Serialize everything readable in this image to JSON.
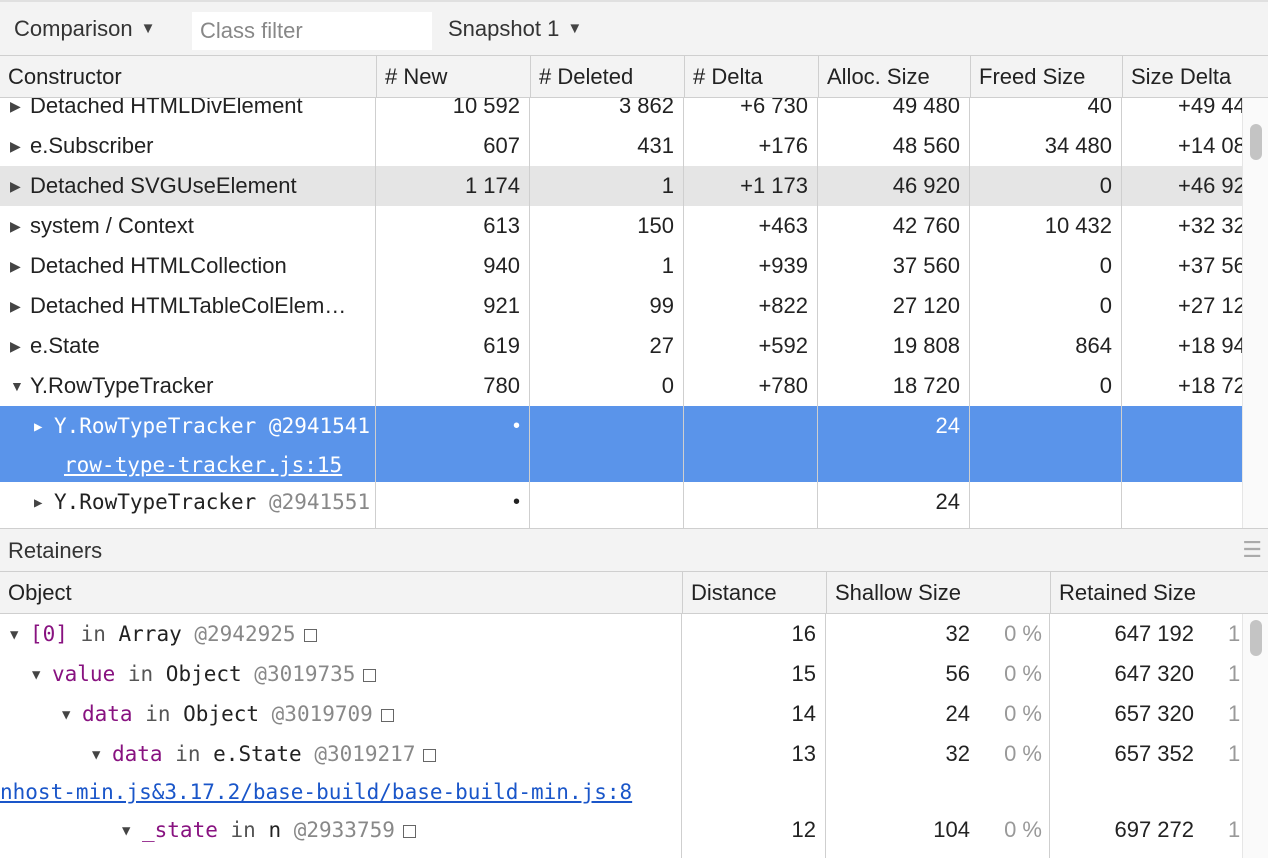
{
  "toolbar": {
    "view_mode": "Comparison",
    "class_filter_placeholder": "Class filter",
    "snapshot": "Snapshot 1"
  },
  "top_table": {
    "columns": [
      "Constructor",
      "# New",
      "# Deleted",
      "# Delta",
      "Alloc. Size",
      "Freed Size",
      "Size Delta"
    ],
    "rows": [
      {
        "name": "Detached HTMLDivElement",
        "new": "10 592",
        "deleted": "3 862",
        "delta": "+6 730",
        "alloc": "49 480",
        "freed": "40",
        "size_delta": "+49 44"
      },
      {
        "name": "e.Subscriber",
        "new": "607",
        "deleted": "431",
        "delta": "+176",
        "alloc": "48 560",
        "freed": "34 480",
        "size_delta": "+14 08"
      },
      {
        "name": "Detached SVGUseElement",
        "new": "1 174",
        "deleted": "1",
        "delta": "+1 173",
        "alloc": "46 920",
        "freed": "0",
        "size_delta": "+46 92"
      },
      {
        "name": "system / Context",
        "new": "613",
        "deleted": "150",
        "delta": "+463",
        "alloc": "42 760",
        "freed": "10 432",
        "size_delta": "+32 32"
      },
      {
        "name": "Detached HTMLCollection",
        "new": "940",
        "deleted": "1",
        "delta": "+939",
        "alloc": "37 560",
        "freed": "0",
        "size_delta": "+37 56"
      },
      {
        "name": "Detached HTMLTableColElem…",
        "new": "921",
        "deleted": "99",
        "delta": "+822",
        "alloc": "27 120",
        "freed": "0",
        "size_delta": "+27 12"
      },
      {
        "name": "e.State",
        "new": "619",
        "deleted": "27",
        "delta": "+592",
        "alloc": "19 808",
        "freed": "864",
        "size_delta": "+18 94"
      },
      {
        "name": "Y.RowTypeTracker",
        "new": "780",
        "deleted": "0",
        "delta": "+780",
        "alloc": "18 720",
        "freed": "0",
        "size_delta": "+18 72"
      }
    ],
    "instances": [
      {
        "label": "Y.RowTypeTracker @2941541",
        "new": "•",
        "alloc": "24",
        "link": "row-type-tracker.js:15"
      },
      {
        "label": "Y.RowTypeTracker @2941551",
        "new": "•",
        "alloc": "24"
      }
    ]
  },
  "retainers": {
    "title": "Retainers",
    "columns": [
      "Object",
      "Distance",
      "Shallow Size",
      "Retained Size"
    ],
    "rows": [
      {
        "prop": "[0]",
        "in": "in",
        "type": "Array",
        "addr": "@2942925",
        "distance": "16",
        "shallow": "32",
        "shallow_pct": "0 %",
        "retained": "647 192",
        "retained_pct": "1"
      },
      {
        "prop": "value",
        "in": "in",
        "type": "Object",
        "addr": "@3019735",
        "distance": "15",
        "shallow": "56",
        "shallow_pct": "0 %",
        "retained": "647 320",
        "retained_pct": "1"
      },
      {
        "prop": "data",
        "in": "in",
        "type": "Object",
        "addr": "@3019709",
        "distance": "14",
        "shallow": "24",
        "shallow_pct": "0 %",
        "retained": "657 320",
        "retained_pct": "1"
      },
      {
        "prop": "data",
        "in": "in",
        "type": "e.State",
        "addr": "@3019217",
        "distance": "13",
        "shallow": "32",
        "shallow_pct": "0 %",
        "retained": "657 352",
        "retained_pct": "1"
      },
      {
        "prop": "_state",
        "in": "in",
        "type": "n",
        "addr": "@2933759",
        "distance": "12",
        "shallow": "104",
        "shallow_pct": "0 %",
        "retained": "697 272",
        "retained_pct": "1"
      }
    ],
    "source_link": "nhost-min.js&3.17.2/base-build/base-build-min.js:8"
  }
}
